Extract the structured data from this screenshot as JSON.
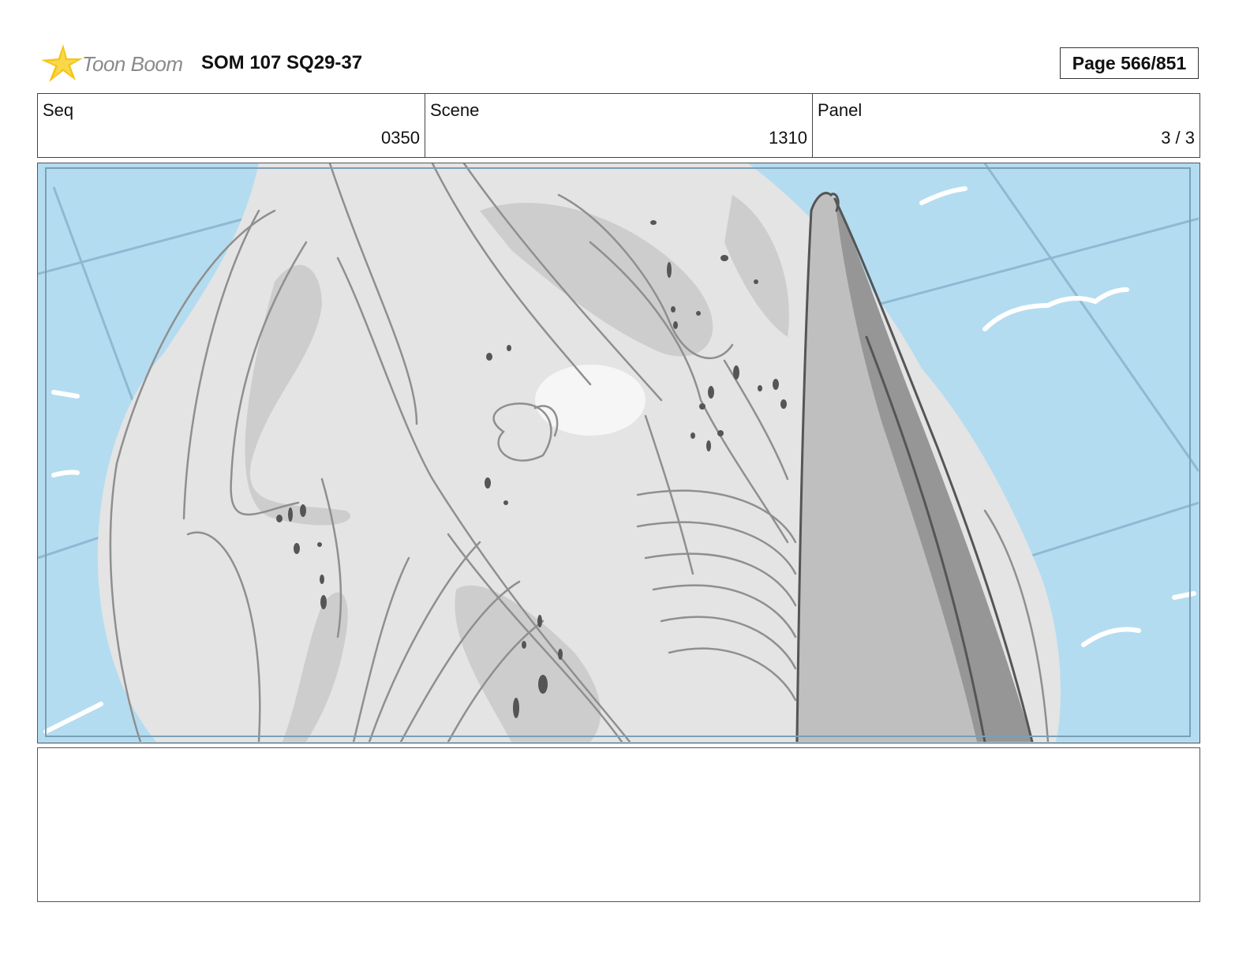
{
  "header": {
    "logo_text": "Toon Boom",
    "title": "SOM 107 SQ29-37",
    "page_label": "Page 566/851"
  },
  "info": {
    "seq": {
      "label": "Seq",
      "value": "0350"
    },
    "scene": {
      "label": "Scene",
      "value": "1310"
    },
    "panel": {
      "label": "Panel",
      "value": "3 / 3"
    }
  },
  "notes": {
    "text": ""
  },
  "colors": {
    "sky": "#b4dcf0",
    "creature": "#e4e4e4",
    "shade": "#c6c6c6",
    "line": "#8f8f8f",
    "fin": "#bfbfbf",
    "fin_dark": "#969696",
    "logo_star": "#f5c518"
  },
  "icons": [
    "toon-boom-star-icon"
  ]
}
